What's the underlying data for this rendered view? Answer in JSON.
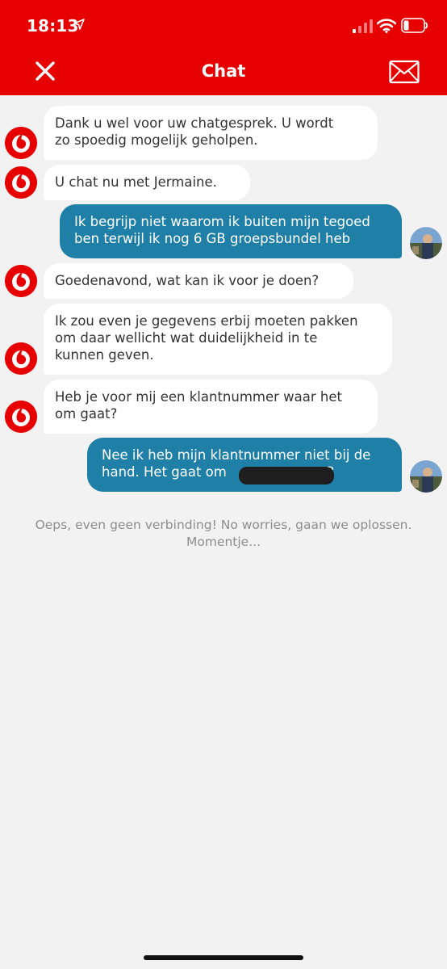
{
  "status_bar": {
    "time": "18:13",
    "icons": [
      "location-arrow-icon",
      "signal-icon",
      "wifi-icon",
      "battery-icon"
    ]
  },
  "header": {
    "title": "Chat",
    "close_icon": "close-icon",
    "mail_icon": "mail-icon",
    "color": "#e60000"
  },
  "messages": [
    {
      "sender": "agent",
      "line1": "Dank u wel voor uw chatgesprek.  U wordt",
      "line2": "zo spoedig mogelijk geholpen."
    },
    {
      "sender": "agent",
      "line1": "U chat nu met Jermaine."
    },
    {
      "sender": "user",
      "line1": "Ik begrijp niet waarom ik buiten mijn tegoed",
      "line2": "ben terwijl ik nog 6 GB groepsbundel heb"
    },
    {
      "sender": "agent",
      "line1": "Goedenavond, wat kan ik voor je doen?"
    },
    {
      "sender": "agent",
      "line1": "Ik zou even je gegevens erbij moeten pakken",
      "line2": "om daar wellicht wat duidelijkheid in te",
      "line3": "kunnen geven."
    },
    {
      "sender": "agent",
      "line1": "Heb je voor mij een klantnummer waar het",
      "line2": "om gaat?"
    },
    {
      "sender": "user",
      "line1": "Nee ik heb mijn klantnummer niet bij de",
      "line2": "hand. Het gaat om ",
      "line2_tail": "3"
    }
  ],
  "connection_status": {
    "line1": "Oeps, even geen verbinding! No worries, gaan we oplossen.",
    "line2": "Momentje..."
  },
  "colors": {
    "brand_red": "#e60000",
    "user_bubble": "#1f7fa6",
    "agent_bubble": "#ffffff",
    "background": "#f2f2f2"
  }
}
